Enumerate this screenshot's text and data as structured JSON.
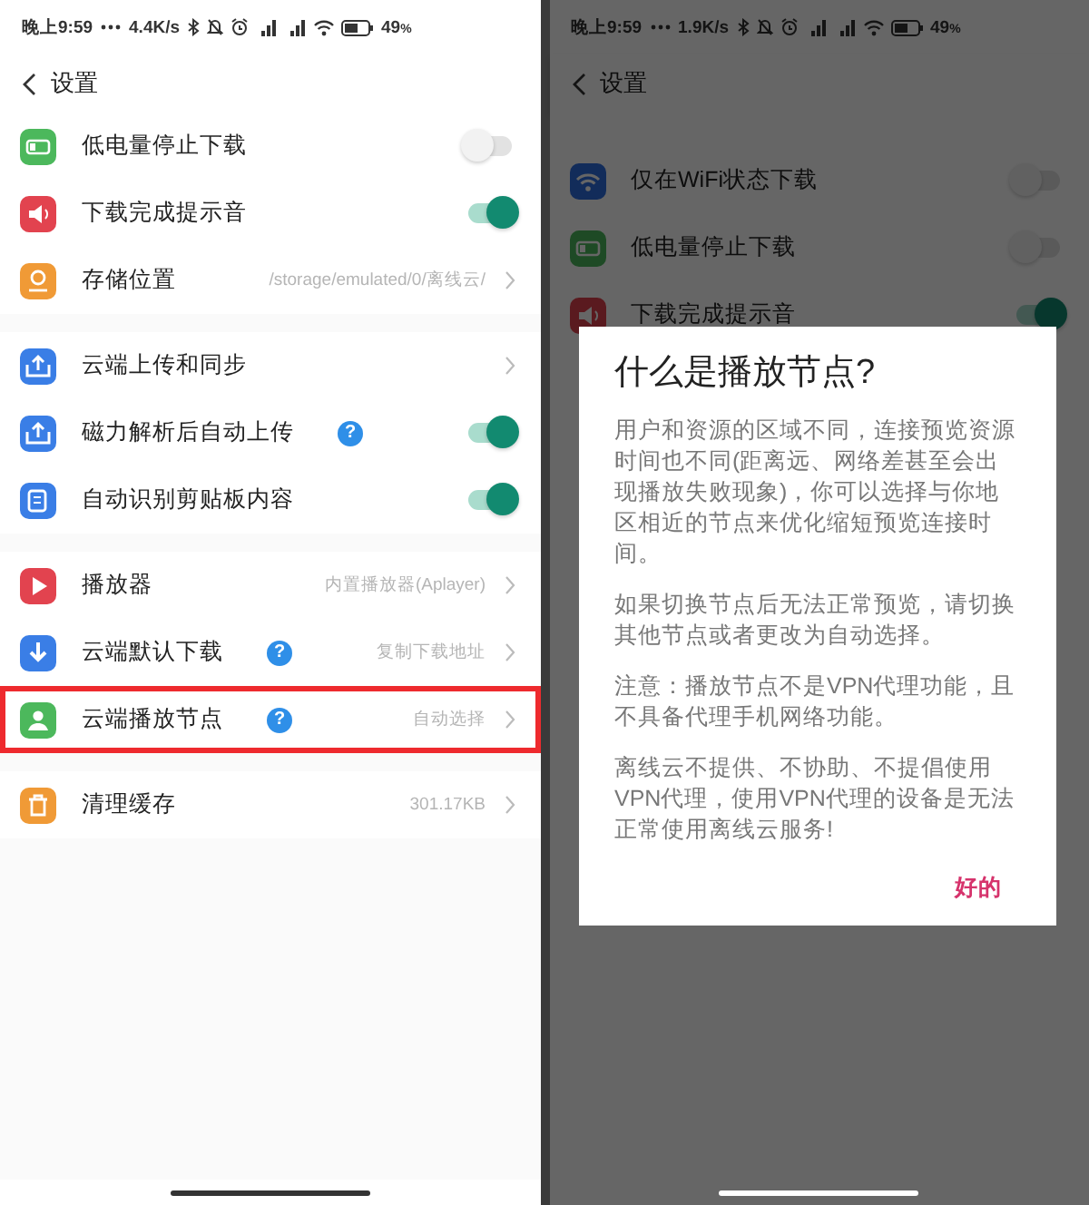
{
  "screens": [
    {
      "status_bar": {
        "time": "晚上9:59",
        "speed": "4.4K/s",
        "battery": "49",
        "percent": "%"
      },
      "header": {
        "title": "设置"
      },
      "groups": [
        [
          {
            "kind": "battery",
            "label": "低电量停止下载",
            "on": false
          },
          {
            "kind": "speaker",
            "label": "下载完成提示音",
            "on": true
          },
          {
            "kind": "pin",
            "label": "存储位置",
            "value": "/storage/emulated/0/离线云/"
          }
        ],
        [
          {
            "kind": "upload",
            "label": "云端上传和同步"
          },
          {
            "kind": "upload",
            "label": "磁力解析后自动上传",
            "help": "?",
            "on": true
          },
          {
            "kind": "clipboard",
            "label": "自动识别剪贴板内容",
            "on": true
          }
        ],
        [
          {
            "kind": "play",
            "label": "播放器",
            "value": "内置播放器(Aplayer)"
          },
          {
            "kind": "download",
            "label": "云端默认下载",
            "help": "?",
            "value": "复制下载地址"
          },
          {
            "kind": "person",
            "label": "云端播放节点",
            "help": "?",
            "value": "自动选择",
            "highlighted": true
          }
        ],
        [
          {
            "kind": "trash",
            "label": "清理缓存",
            "value": "301.17KB"
          }
        ]
      ]
    },
    {
      "status_bar": {
        "time": "晚上9:59",
        "speed": "1.9K/s",
        "battery": "49",
        "percent": "%"
      },
      "header": {
        "title": "设置"
      },
      "groups": [
        [
          {
            "kind": "wifi",
            "label": "仅在WiFi状态下载",
            "on": false
          },
          {
            "kind": "battery",
            "label": "低电量停止下载",
            "on": false
          },
          {
            "kind": "speaker",
            "label": "下载完成提示音",
            "on": true
          }
        ]
      ],
      "dialog": {
        "title": "什么是播放节点?",
        "paragraphs": [
          "用户和资源的区域不同，连接预览资源时间也不同(距离远、网络差甚至会出现播放失败现象)，你可以选择与你地区相近的节点来优化缩短预览连接时间。",
          "如果切换节点后无法正常预览，请切换其他节点或者更改为自动选择。",
          "注意：播放节点不是VPN代理功能，且不具备代理手机网络功能。",
          "离线云不提供、不协助、不提倡使用VPN代理，使用VPN代理的设备是无法正常使用离线云服务!"
        ],
        "button": "好的"
      }
    }
  ]
}
